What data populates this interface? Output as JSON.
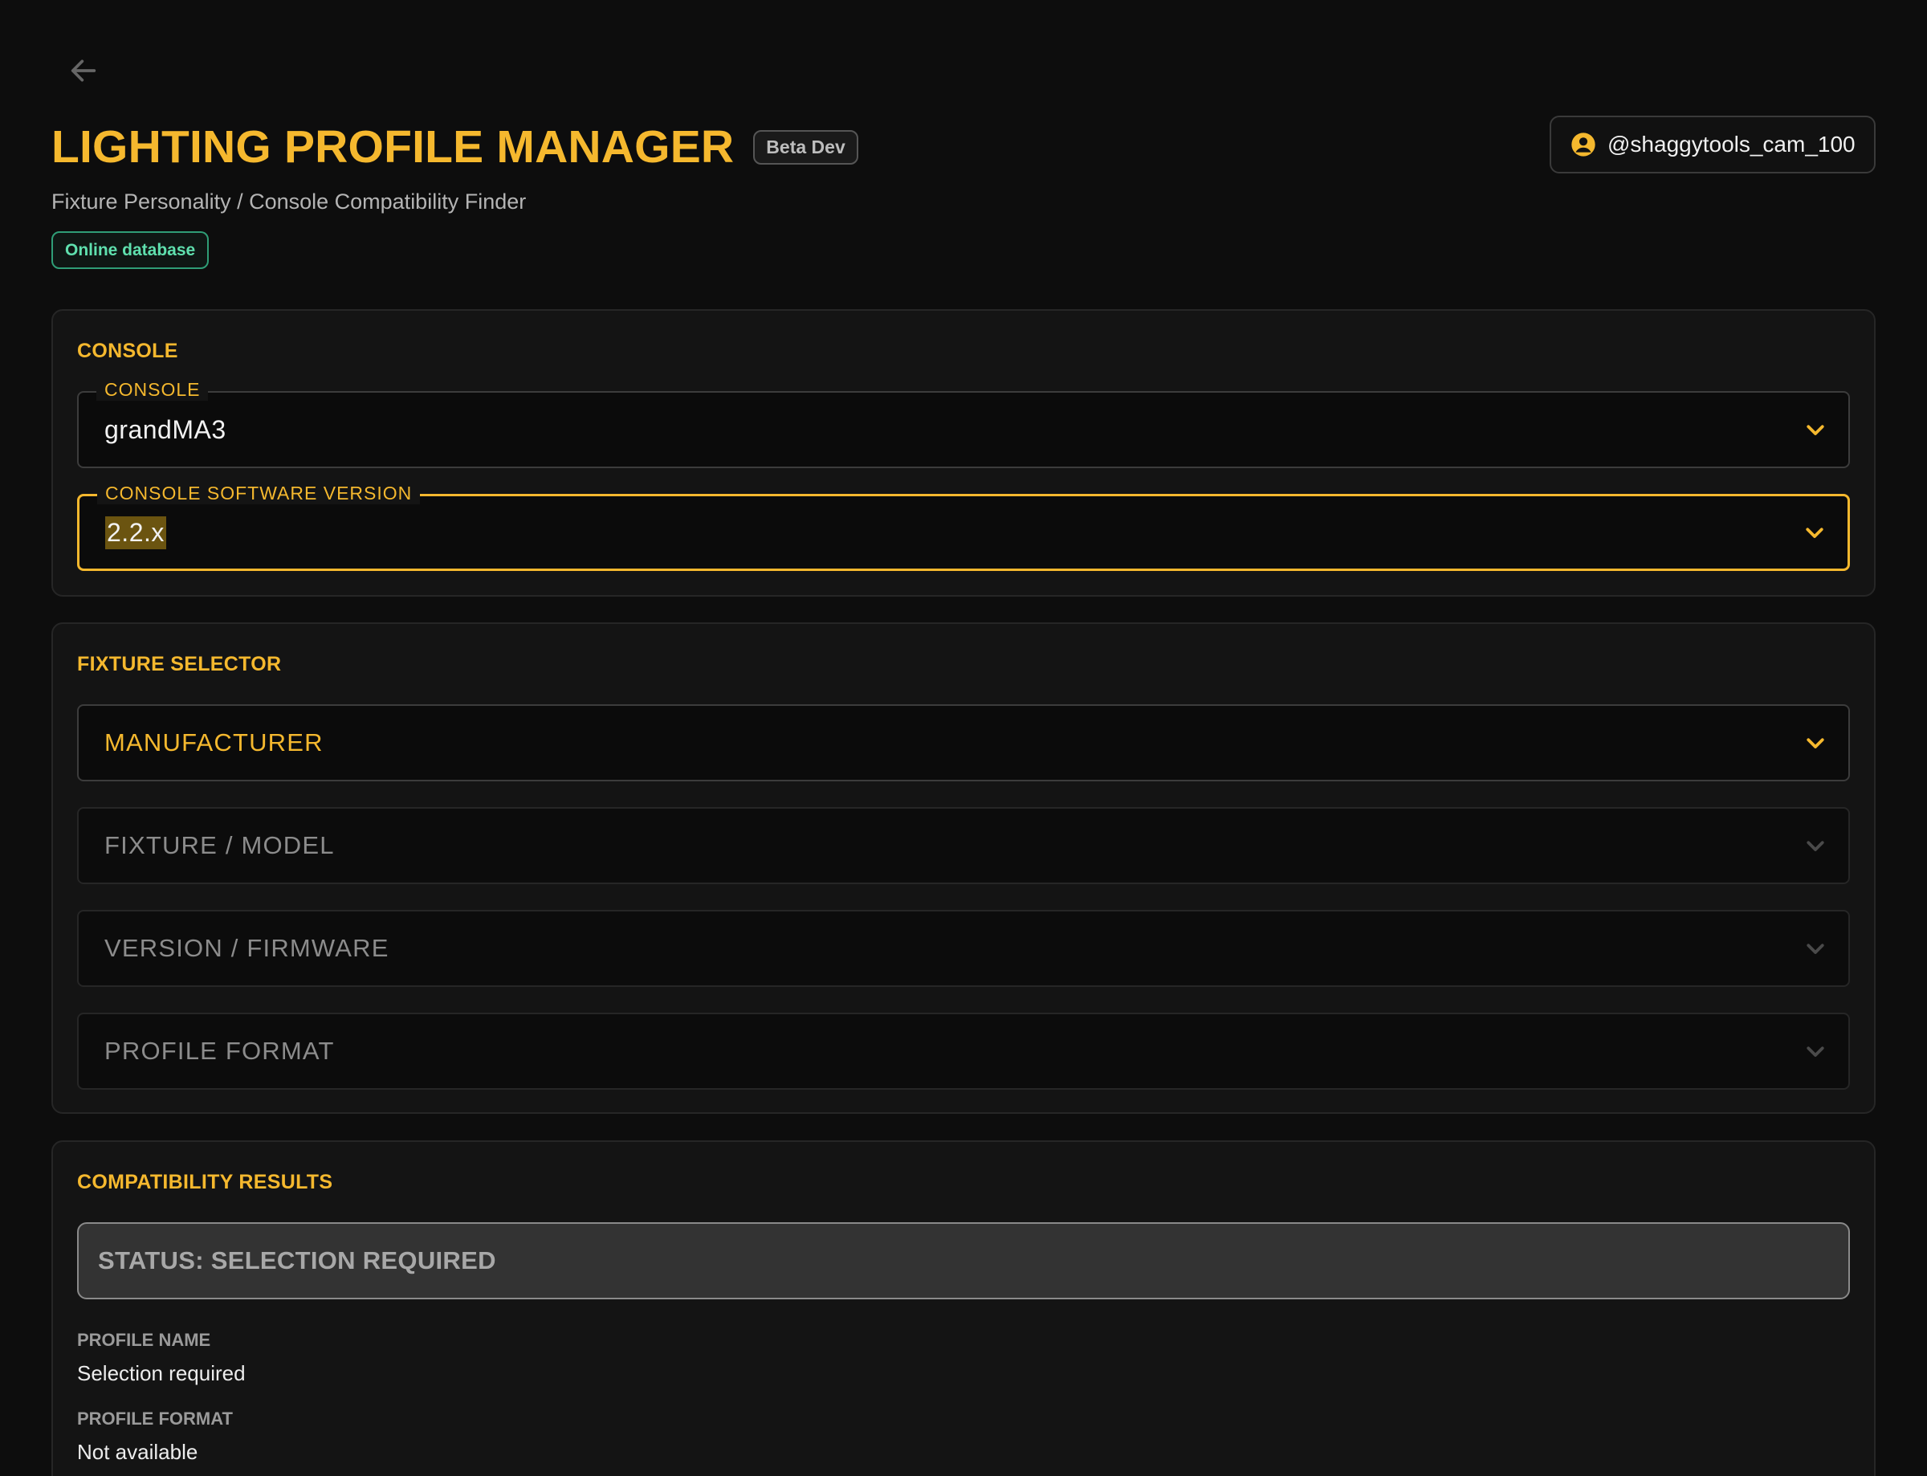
{
  "header": {
    "title": "LIGHTING PROFILE MANAGER",
    "badge": "Beta Dev",
    "subtitle": "Fixture Personality / Console Compatibility Finder",
    "db_status": "Online database",
    "user": "@shaggytools_cam_100",
    "back_icon": "arrow-left-icon",
    "user_icon": "account-circle-icon"
  },
  "console_section": {
    "title": "CONSOLE",
    "console_field": {
      "label": "CONSOLE",
      "value": "grandMA3"
    },
    "version_field": {
      "label": "CONSOLE SOFTWARE VERSION",
      "value": "2.2.x"
    }
  },
  "fixture_section": {
    "title": "FIXTURE SELECTOR",
    "manufacturer": "MANUFACTURER",
    "model": "FIXTURE / MODEL",
    "firmware": "VERSION / FIRMWARE",
    "format": "PROFILE FORMAT"
  },
  "results_section": {
    "title": "COMPATIBILITY RESULTS",
    "status": "STATUS: SELECTION REQUIRED",
    "profile_name_label": "PROFILE NAME",
    "profile_name_value": "Selection required",
    "profile_format_label": "PROFILE FORMAT",
    "profile_format_value": "Not available"
  },
  "colors": {
    "accent": "#f5b82e",
    "background": "#0d0d0d",
    "card": "#141414",
    "online": "#5fe0ae"
  }
}
